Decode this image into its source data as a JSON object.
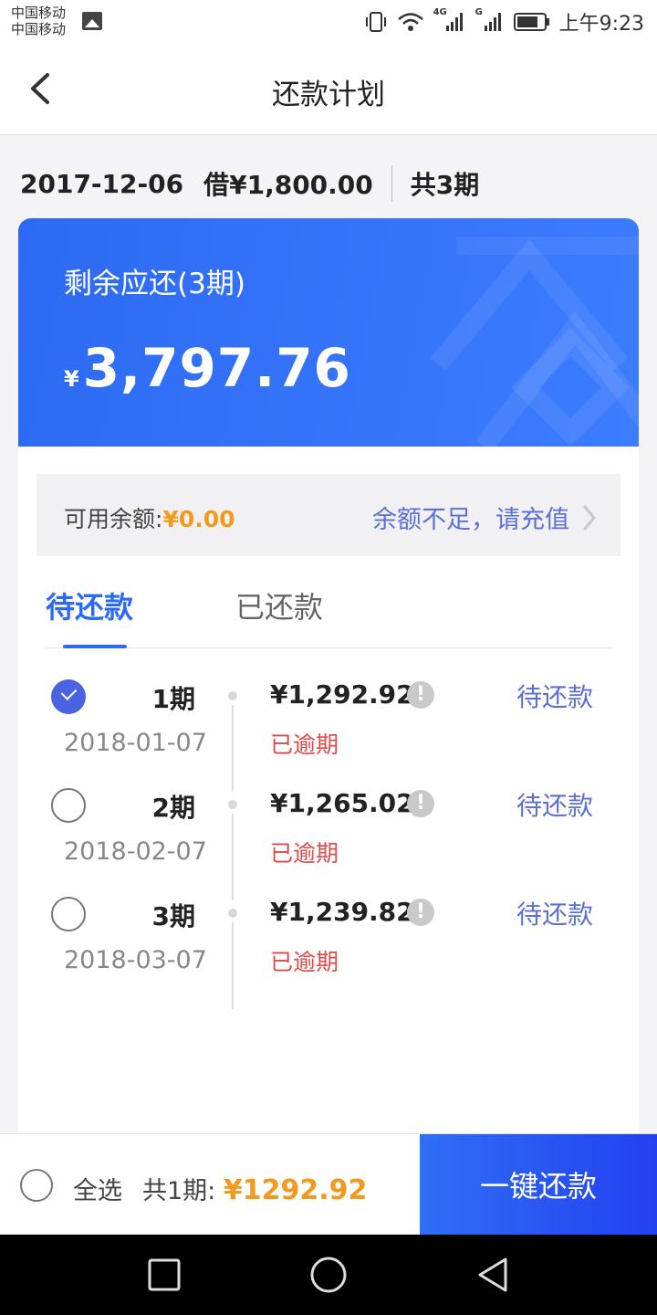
{
  "status_bar": {
    "carrier_1": "中国移动",
    "carrier_2": "中国移动",
    "net_1": "4G",
    "net_2": "G",
    "time": "上午9:23"
  },
  "header": {
    "title": "还款计划"
  },
  "loan": {
    "date": "2017-12-06",
    "amount": "借¥1,800.00",
    "periods": "共3期"
  },
  "card": {
    "label": "剩余应还(3期)",
    "currency": "¥",
    "amount": "3,797.76"
  },
  "balance": {
    "label": "可用余额:",
    "value": "¥0.00",
    "recharge_text": "余额不足，请充值"
  },
  "tabs": {
    "pending": "待还款",
    "paid": "已还款"
  },
  "installments": [
    {
      "period": "1期",
      "date": "2018-01-07",
      "amount": "¥1,292.92",
      "overdue": "已逾期",
      "status": "待还款",
      "checked": true
    },
    {
      "period": "2期",
      "date": "2018-02-07",
      "amount": "¥1,265.02",
      "overdue": "已逾期",
      "status": "待还款",
      "checked": false
    },
    {
      "period": "3期",
      "date": "2018-03-07",
      "amount": "¥1,239.82",
      "overdue": "已逾期",
      "status": "待还款",
      "checked": false
    }
  ],
  "bottom": {
    "select_all": "全选",
    "total_prefix": "共1期:",
    "total_amount": "¥1292.92",
    "pay_button": "一键还款"
  },
  "colors": {
    "primary": "#2d6af3",
    "accent_orange": "#f39a1e",
    "overdue_red": "#e04a4a",
    "link_blue": "#5b6fd6"
  },
  "icons": {
    "back": "back-arrow-icon",
    "info": "exclamation-circle-icon",
    "chevron": "chevron-right-icon"
  }
}
